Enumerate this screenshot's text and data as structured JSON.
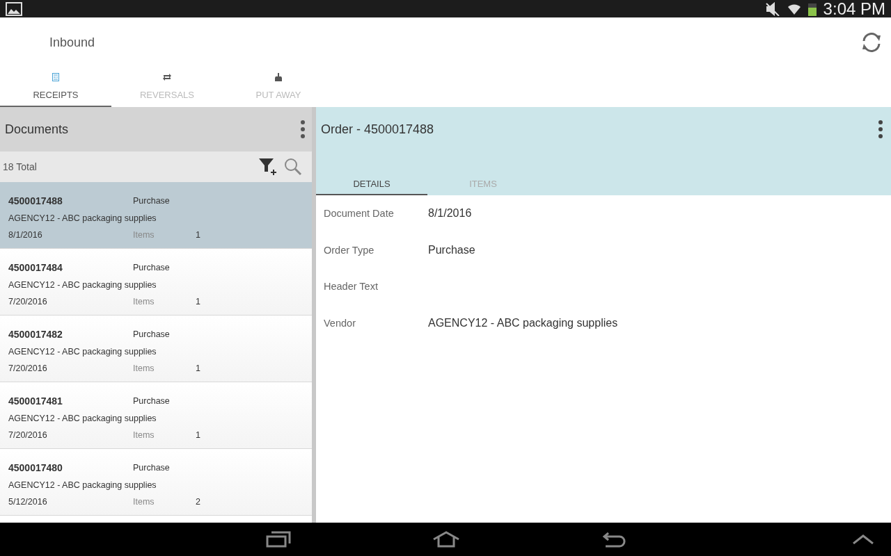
{
  "status_bar": {
    "time": "3:04 PM"
  },
  "app_bar": {
    "title": "Inbound"
  },
  "tabs": [
    {
      "label": "RECEIPTS",
      "kind": "receipt",
      "selected": true
    },
    {
      "label": "REVERSALS",
      "kind": "reversal",
      "selected": false
    },
    {
      "label": "PUT AWAY",
      "kind": "putaway",
      "selected": false
    }
  ],
  "documents": {
    "title": "Documents",
    "total": "18 Total",
    "rows": [
      {
        "number": "4500017488",
        "type": "Purchase",
        "vendor": "AGENCY12 - ABC packaging supplies",
        "date": "8/1/2016",
        "items_label": "Items",
        "items": "1",
        "selected": true
      },
      {
        "number": "4500017484",
        "type": "Purchase",
        "vendor": "AGENCY12 - ABC packaging supplies",
        "date": "7/20/2016",
        "items_label": "Items",
        "items": "1",
        "selected": false
      },
      {
        "number": "4500017482",
        "type": "Purchase",
        "vendor": "AGENCY12 - ABC packaging supplies",
        "date": "7/20/2016",
        "items_label": "Items",
        "items": "1",
        "selected": false
      },
      {
        "number": "4500017481",
        "type": "Purchase",
        "vendor": "AGENCY12 - ABC packaging supplies",
        "date": "7/20/2016",
        "items_label": "Items",
        "items": "1",
        "selected": false
      },
      {
        "number": "4500017480",
        "type": "Purchase",
        "vendor": "AGENCY12 - ABC packaging supplies",
        "date": "5/12/2016",
        "items_label": "Items",
        "items": "2",
        "selected": false
      }
    ]
  },
  "detail": {
    "title": "Order - 4500017488",
    "tabs": [
      {
        "label": "DETAILS",
        "selected": true
      },
      {
        "label": "ITEMS",
        "selected": false
      }
    ],
    "fields": [
      {
        "label": "Document Date",
        "value": "8/1/2016"
      },
      {
        "label": "Order Type",
        "value": "Purchase"
      },
      {
        "label": "Header Text"
      },
      {
        "label": "Vendor",
        "value": "AGENCY12 - ABC packaging supplies"
      }
    ]
  }
}
